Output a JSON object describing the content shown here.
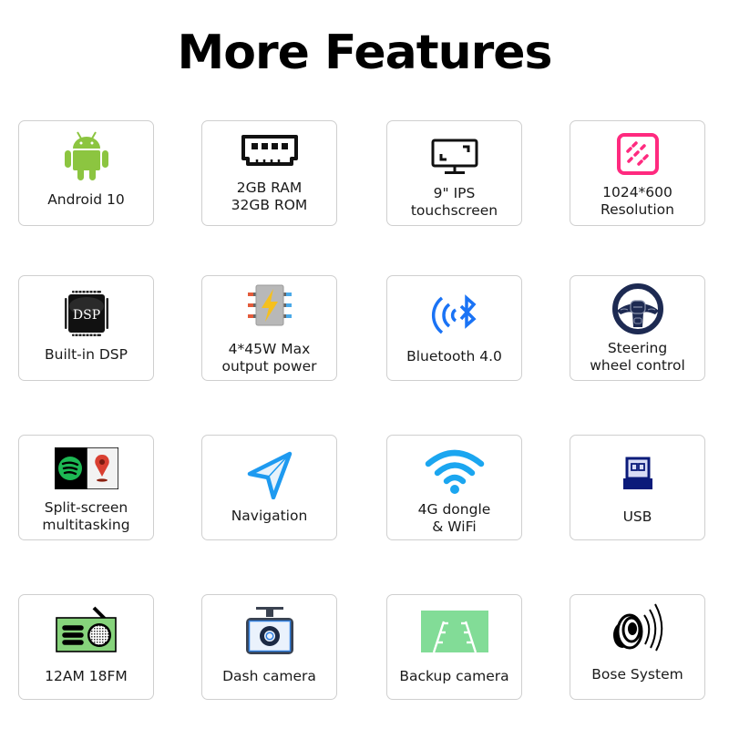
{
  "header": {
    "title": "More Features"
  },
  "features": [
    {
      "id": "android",
      "icon": "android-icon",
      "label": "Android 10",
      "color": "#8cc540"
    },
    {
      "id": "memory",
      "icon": "ram-chip-icon",
      "label": "2GB RAM\n32GB ROM",
      "color": "#111111"
    },
    {
      "id": "screen",
      "icon": "monitor-icon",
      "label": "9\" IPS\ntouchscreen",
      "color": "#111111"
    },
    {
      "id": "resolution",
      "icon": "resolution-icon",
      "label": "1024*600\nResolution",
      "color": "#ff2a7f"
    },
    {
      "id": "dsp",
      "icon": "dsp-chip-icon",
      "label": "Built-in DSP",
      "color": "#111111"
    },
    {
      "id": "power",
      "icon": "power-amplifier-icon",
      "label": "4*45W Max\noutput power",
      "color": "#f5c01f"
    },
    {
      "id": "bluetooth",
      "icon": "bluetooth-icon",
      "label": "Bluetooth 4.0",
      "color": "#1a73f5"
    },
    {
      "id": "steering",
      "icon": "steering-wheel-icon",
      "label": "Steering\nwheel control",
      "color": "#1d2a52"
    },
    {
      "id": "split",
      "icon": "split-screen-icon",
      "label": "Split-screen\nmultitasking",
      "color": "#1db954"
    },
    {
      "id": "navigation",
      "icon": "navigation-arrow-icon",
      "label": "Navigation",
      "color": "#1e9af0"
    },
    {
      "id": "wifi",
      "icon": "wifi-icon",
      "label": "4G dongle\n& WiFi",
      "color": "#1ba6f0"
    },
    {
      "id": "usb",
      "icon": "usb-icon",
      "label": "USB",
      "color": "#0b1b7a"
    },
    {
      "id": "radio",
      "icon": "radio-icon",
      "label": "12AM 18FM",
      "color": "#86d37b"
    },
    {
      "id": "dashcam",
      "icon": "dash-camera-icon",
      "label": "Dash camera",
      "color": "#2f7fe0"
    },
    {
      "id": "backup",
      "icon": "backup-camera-icon",
      "label": "Backup camera",
      "color": "#82dc97"
    },
    {
      "id": "bose",
      "icon": "speaker-icon",
      "label": "Bose System",
      "color": "#000000"
    }
  ]
}
